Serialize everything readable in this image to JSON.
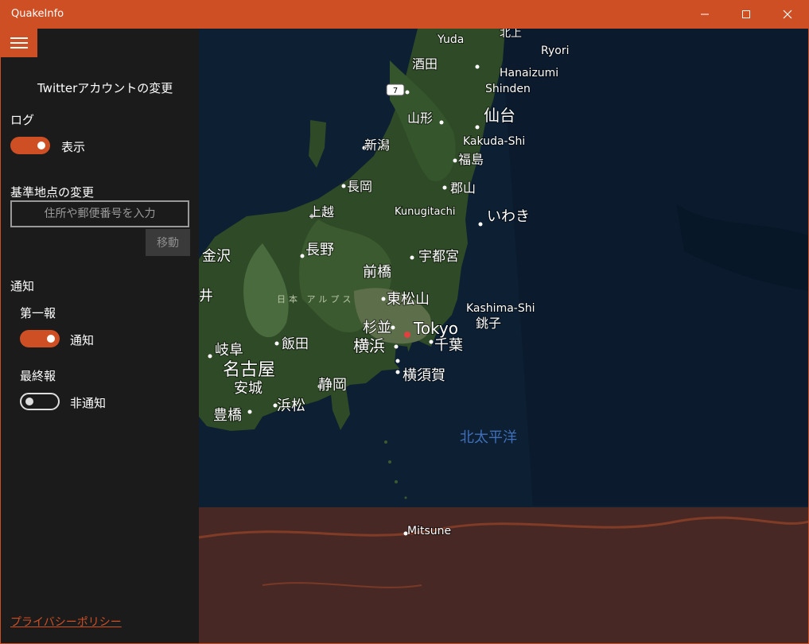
{
  "window": {
    "title": "QuakeInfo"
  },
  "sidebar": {
    "twitter_link": "Twitterアカウントの変更",
    "log": {
      "heading": "ログ",
      "toggle_label": "表示",
      "toggle_on": true
    },
    "location": {
      "heading": "基準地点の変更",
      "placeholder": "住所や郵便番号を入力",
      "move_button": "移動"
    },
    "notification": {
      "heading": "通知",
      "first_report": {
        "label": "第一報",
        "toggle_label": "通知",
        "toggle_on": true
      },
      "final_report": {
        "label": "最終報",
        "toggle_label": "非通知",
        "toggle_on": false
      }
    },
    "privacy_link": "プライバシーポリシー"
  },
  "map": {
    "route_shield": "7",
    "places": {
      "yuda": "Yuda",
      "kitakami": "北上",
      "ryori": "Ryori",
      "sakata": "酒田",
      "hanaizumi": "Hanaizumi",
      "shinden": "Shinden",
      "yamagata": "山形",
      "sendai": "仙台",
      "niigata": "新潟",
      "kakuda": "Kakuda-Shi",
      "fukushima": "福島",
      "nagaoka": "長岡",
      "koriyama": "郡山",
      "joetsu": "上越",
      "kunugitachi": "Kunugitachi",
      "iwaki": "いわき",
      "kanazawa": "金沢",
      "nagano": "長野",
      "utsunomiya": "宇都宮",
      "maebashi": "前橋",
      "japan_alps": "日本 アルプス",
      "higashimatsuyama": "東松山",
      "kashima": "Kashima-Shi",
      "sugi": "杉並",
      "tokyo": "Tokyo",
      "choshi": "銚子",
      "gifu": "岐阜",
      "iida": "飯田",
      "yokohama": "横浜",
      "chiba": "千葉",
      "nagoya": "名古屋",
      "anjo": "安城",
      "shizuoka": "静岡",
      "yokosuka": "横須賀",
      "hamamatsu": "浜松",
      "toyohashi": "豊橋",
      "pacific": "北太平洋",
      "mitsune": "Mitsune",
      "fukui": "井"
    }
  }
}
